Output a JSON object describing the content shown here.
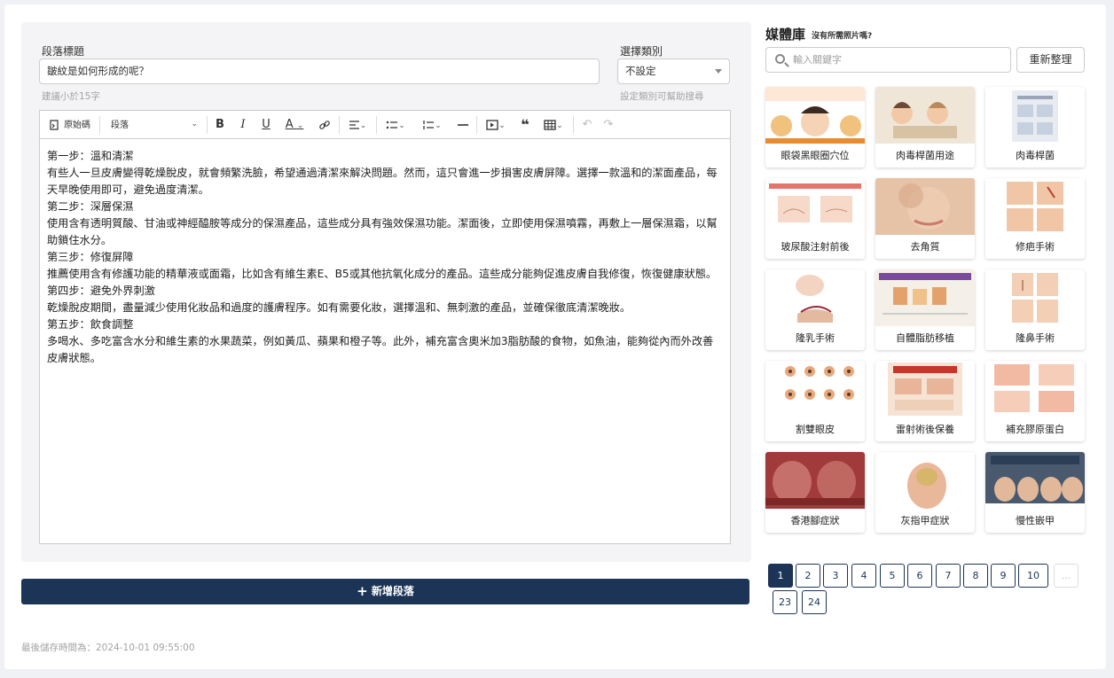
{
  "editor": {
    "title_label": "段落標題",
    "title_value": "皺紋是如何形成的呢？",
    "title_hint": "建議小於15字",
    "category_label": "選擇類別",
    "category_value": "不設定",
    "category_hint": "設定類別可幫助搜尋",
    "toolbar": {
      "source_label": "原始碼",
      "format_label": "段落"
    },
    "paragraphs": [
      "第一步：溫和清潔",
      "有些人一旦皮膚變得乾燥脫皮，就會頻繁洗臉，希望通過清潔來解決問題。然而，這只會進一步損害皮膚屏障。選擇一款溫和的潔面產品，每天早晚使用即可，避免過度清潔。",
      "第二步：深層保濕",
      "使用含有透明質酸、甘油或神經醯胺等成分的保濕產品，這些成分具有強效保濕功能。潔面後，立即使用保濕噴霧，再敷上一層保濕霜，以幫助鎖住水分。",
      "第三步：修復屏障",
      "推薦使用含有修護功能的精華液或面霜，比如含有維生素E、B5或其他抗氧化成分的產品。這些成分能夠促進皮膚自我修復，恢復健康狀態。",
      "第四步：避免外界刺激",
      "乾燥脫皮期間，盡量減少使用化妝品和過度的護膚程序。如有需要化妝，選擇溫和、無刺激的產品，並確保徹底清潔晚妝。",
      "第五步：飲食調整",
      "多喝水、多吃富含水分和維生素的水果蔬菜，例如黃瓜、蘋果和橙子等。此外，補充富含奧米加3脂肪酸的食物，如魚油，能夠從內而外改善皮膚狀態。"
    ],
    "add_paragraph_label": "新增段落",
    "saved_text": "最後儲存時間為：2024-10-01 09:55:00"
  },
  "media": {
    "title": "媒體庫",
    "subtitle": "沒有所需照片嗎?",
    "search_placeholder": "輸入關鍵字",
    "refresh_label": "重新整理",
    "items": [
      {
        "caption": "眼袋黑眼圈穴位",
        "thumb_text": "眼袋,黑眼圈還揮消不掉?"
      },
      {
        "caption": "肉毒桿菌用途",
        "thumb_text": ""
      },
      {
        "caption": "肉毒桿菌",
        "thumb_text": ""
      },
      {
        "caption": "玻尿酸注射前後",
        "thumb_text": ""
      },
      {
        "caption": "去角質",
        "thumb_text": ""
      },
      {
        "caption": "修疤手術",
        "thumb_text": ""
      },
      {
        "caption": "隆乳手術",
        "thumb_text": ""
      },
      {
        "caption": "自體脂肪移植",
        "thumb_text": ""
      },
      {
        "caption": "隆鼻手術",
        "thumb_text": ""
      },
      {
        "caption": "割雙眼皮",
        "thumb_text": ""
      },
      {
        "caption": "雷射術後保養",
        "thumb_text": ""
      },
      {
        "caption": "補充膠原蛋白",
        "thumb_text": ""
      },
      {
        "caption": "香港腳症狀",
        "thumb_text": ""
      },
      {
        "caption": "灰指甲症狀",
        "thumb_text": ""
      },
      {
        "caption": "慢性嵌甲",
        "thumb_text": ""
      }
    ],
    "pages": [
      "1",
      "2",
      "3",
      "4",
      "5",
      "6",
      "7",
      "8",
      "9",
      "10",
      "...",
      "23",
      "24"
    ],
    "current_page": "1"
  },
  "colors": {
    "primary": "#1c3557",
    "hint": "#a3a3a3",
    "card_bg": "#f4f4f6"
  }
}
